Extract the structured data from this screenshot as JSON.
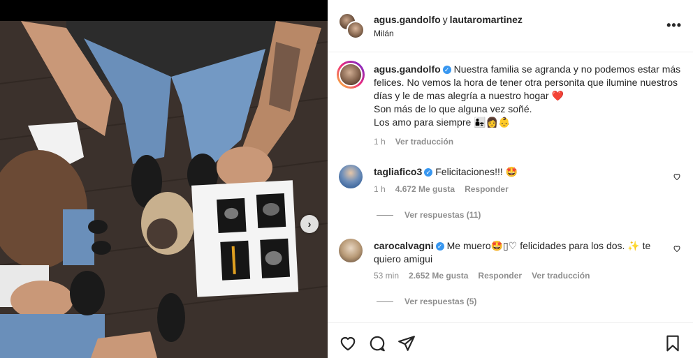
{
  "header": {
    "user1": "agus.gandolfo",
    "and": "y",
    "user2": "lautaromartinez",
    "location": "Milán",
    "more": "•••"
  },
  "caption": {
    "username": "agus.gandolfo",
    "line1": "Nuestra familia se agranda y no podemos estar más felices. No vemos la hora de tener otra personita que ilumine nuestros días y le de mas alegría a nuestro hogar",
    "heart": "❤️",
    "line2": "Son más de lo que alguna vez soñé.",
    "line3": "Los amo para siempre",
    "emojis": "👨‍👧👩👶",
    "time": "1 h",
    "translate": "Ver traducción"
  },
  "comments": [
    {
      "username": "tagliafico3",
      "text": "Felicitaciones!!! 🤩",
      "time": "1 h",
      "likes": "4.672 Me gusta",
      "reply": "Responder",
      "view_replies": "Ver respuestas (11)"
    },
    {
      "username": "carocalvagni",
      "text": "Me muero🤩▯♡ felicidades para los dos. ✨ te quiero amigui",
      "time": "53 min",
      "likes": "2.652 Me gusta",
      "reply": "Responder",
      "translate": "Ver traducción",
      "view_replies": "Ver respuestas (5)"
    }
  ],
  "photo": {
    "next": "›"
  },
  "icons": [
    "heart-icon",
    "comment-icon",
    "share-icon",
    "bookmark-icon",
    "verified-icon",
    "more-icon",
    "chevron-right-icon"
  ],
  "colors": {
    "verified": "#3897f0",
    "muted": "#8e8e8e",
    "text": "#262626"
  }
}
